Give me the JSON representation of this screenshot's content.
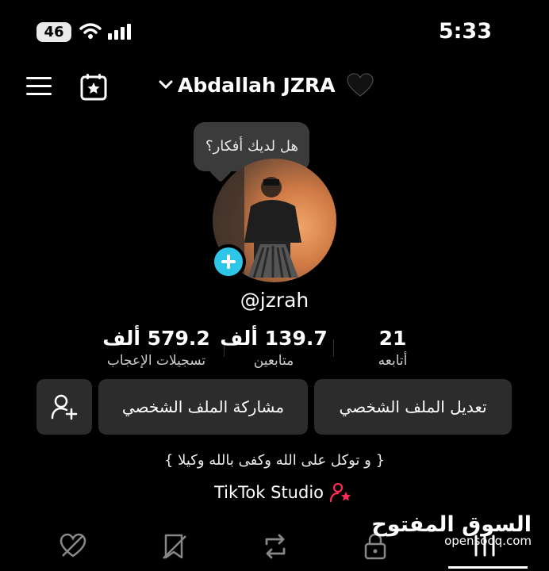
{
  "status_bar": {
    "battery": "46",
    "time": "5:33"
  },
  "header": {
    "account_name": "Abdallah JZRA",
    "emoji": "🖤"
  },
  "bubble": {
    "text": "هل لديك أفكار؟"
  },
  "profile": {
    "username": "@jzrah"
  },
  "stats": [
    {
      "value": "579.2 ألف",
      "label": "تسجيلات الإعجاب"
    },
    {
      "value": "139.7 ألف",
      "label": "متابعين"
    },
    {
      "value": "21",
      "label": "أتابعه"
    }
  ],
  "actions": {
    "edit_profile": "تعديل الملف الشخصي",
    "share_profile": "مشاركة الملف الشخصي"
  },
  "bio": {
    "text": "{ و توكل على الله وكفى بالله وكيلا }"
  },
  "studio": {
    "label": "TikTok Studio"
  },
  "watermark": {
    "arabic": "السوق المفتوح",
    "latin": "opensooq.com"
  },
  "colors": {
    "accent": "#2ec6e8",
    "studio": "#fe2c55",
    "button_bg": "#2c2c2c",
    "bubble_bg": "#3b3b3b"
  }
}
